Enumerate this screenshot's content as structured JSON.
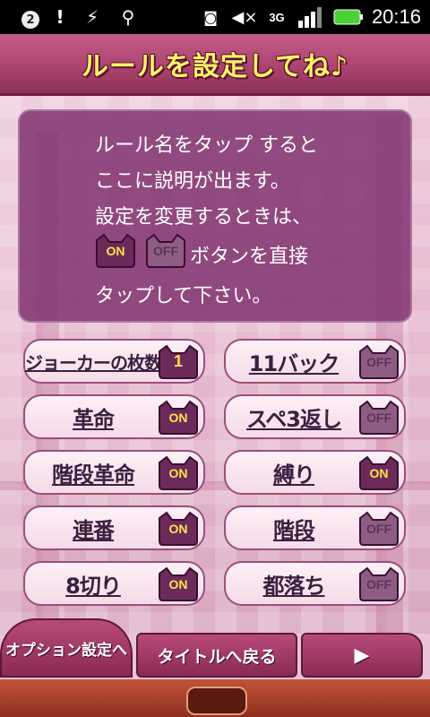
{
  "status_bar": {
    "notification_count": "2",
    "time": "20:16",
    "network": "3G"
  },
  "header": {
    "title": "ルールを設定してね♪"
  },
  "info": {
    "lines": [
      "ルール名をタップ すると",
      "ここに説明が出ます。",
      "設定を変更するときは、",
      "ボタンを直接",
      "タップして下さい。"
    ],
    "on_label": "ON",
    "off_label": "OFF"
  },
  "rules": [
    {
      "label": "ジョーカーの枚数",
      "value": "1"
    },
    {
      "label": "11バック",
      "value": "OFF"
    },
    {
      "label": "革命",
      "value": "ON"
    },
    {
      "label": "スペ3返し",
      "value": "OFF"
    },
    {
      "label": "階段革命",
      "value": "ON"
    },
    {
      "label": "縛り",
      "value": "ON"
    },
    {
      "label": "連番",
      "value": "ON"
    },
    {
      "label": "階段",
      "value": "OFF"
    },
    {
      "label": "8切り",
      "value": "ON"
    },
    {
      "label": "都落ち",
      "value": "OFF"
    }
  ],
  "bottom": {
    "options_label": "オプション設定へ",
    "title_label": "タイトルへ戻る",
    "next_label": "▶"
  },
  "colors": {
    "on_toggle": "#6b2a5a",
    "on_text": "#ffe24a",
    "off_toggle": "#8f5c84",
    "off_text": "#5a3458",
    "accent": "#a8426d"
  }
}
